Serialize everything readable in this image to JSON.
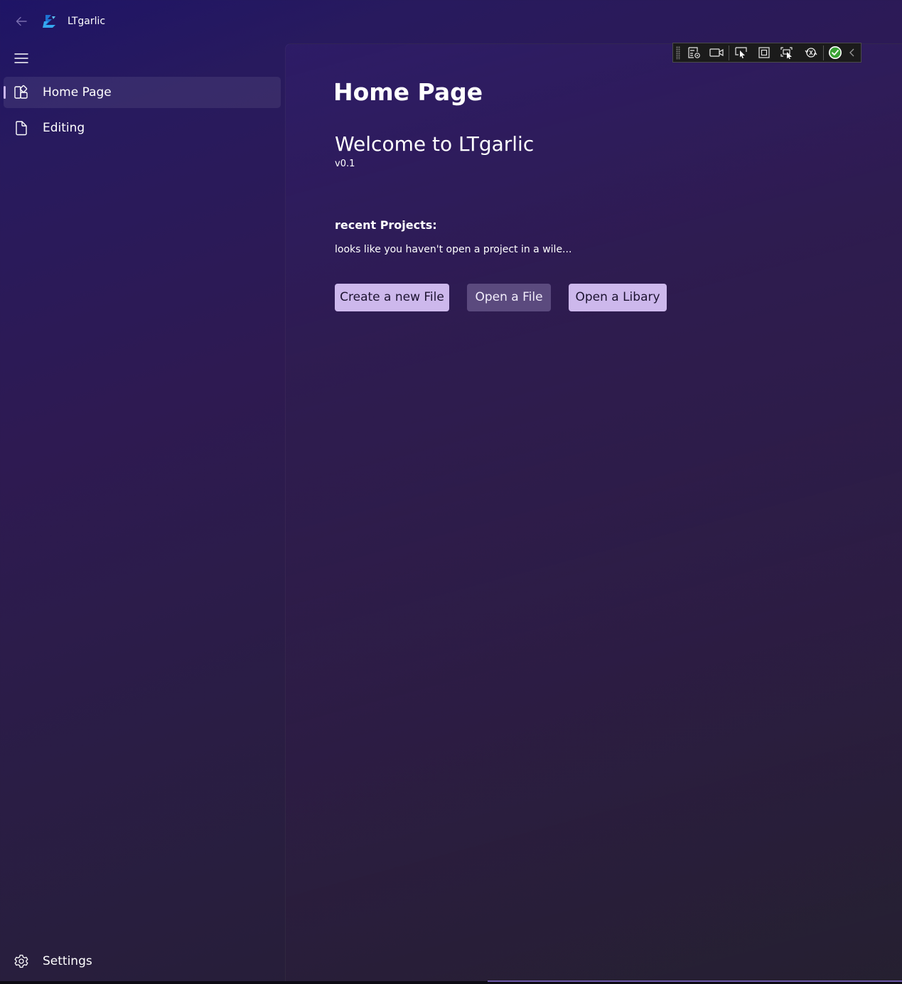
{
  "window": {
    "app_title": "LTgarlic"
  },
  "navigation": {
    "items": [
      {
        "label": "Home Page",
        "icon": "home-grid-icon",
        "selected": true
      },
      {
        "label": "Editing",
        "icon": "document-icon",
        "selected": false
      }
    ],
    "footer": {
      "label": "Settings",
      "icon": "gear-icon"
    }
  },
  "main": {
    "page_title": "Home Page",
    "welcome": "Welcome to LTgarlic",
    "version": "v0.1",
    "recent_label": "recent Projects:",
    "recent_empty_message": "looks like you haven't open a project in a wile...",
    "buttons": {
      "create": "Create a new File",
      "open_file": "Open a File",
      "open_library": "Open a Libary"
    }
  },
  "debug_toolbar": {
    "tools": [
      "live-visual-tree-icon",
      "record-icon",
      "select-element-icon",
      "display-layout-adorners-icon",
      "track-focus-icon",
      "hot-reload-icon",
      "ok-status-icon",
      "collapse-chevron-icon"
    ]
  },
  "colors": {
    "accent_button": "#cdb8ec",
    "secondary_button": "#5b4a7e",
    "selection_indicator": "#c9b5ec",
    "logo_blue": "#2a8ae0"
  }
}
